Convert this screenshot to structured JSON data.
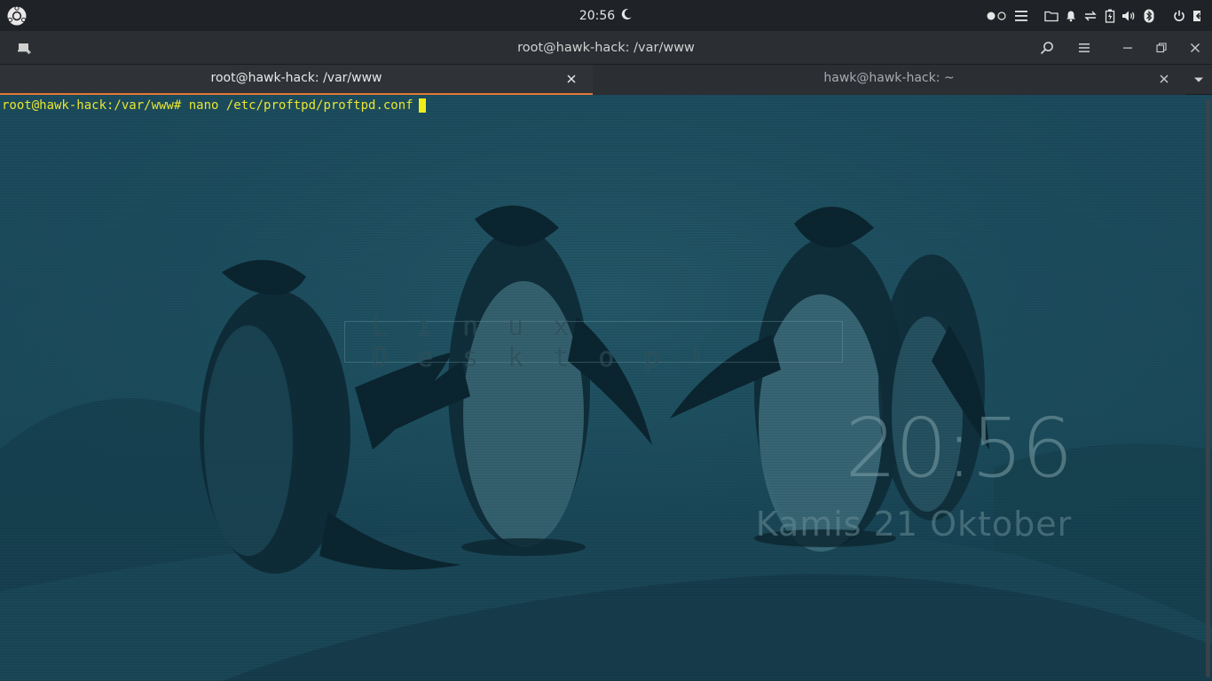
{
  "top_panel": {
    "clock": "20:56",
    "icons": {
      "menu": "ubuntu-logo-icon",
      "night_mode": "moon-icon",
      "workspaces": "workspace-dots-icon",
      "hamburger": "menu-icon",
      "files": "folder-icon",
      "notifications": "bell-icon",
      "network": "network-transfer-icon",
      "battery": "battery-icon",
      "volume": "volume-icon",
      "bluetooth": "bluetooth-icon",
      "power": "power-icon",
      "logout": "logout-icon"
    }
  },
  "window": {
    "title": "root@hawk-hack: /var/www",
    "icons": {
      "new_tab": "new-tab-icon",
      "search": "search-icon",
      "menu": "menu-icon",
      "minimize": "minimize-icon",
      "restore": "restore-icon",
      "close": "close-icon"
    }
  },
  "tabs": [
    {
      "label": "root@hawk-hack: /var/www",
      "active": true
    },
    {
      "label": "hawk@hawk-hack: ~",
      "active": false
    }
  ],
  "terminal": {
    "prompt": "root@hawk-hack:/var/www#",
    "command": " nano /etc/proftpd/proftpd.conf"
  },
  "desktop": {
    "banner": "Linux Desktop!",
    "widget_time": "20:56",
    "widget_date": "Kamis 21 Oktober"
  },
  "colors": {
    "panel": "#1f2226",
    "titlebar": "#2b2e33",
    "active_tab_accent": "#e07b3a",
    "terminal_text": "#e9e532",
    "wallpaper_tint": "#123b4a"
  }
}
